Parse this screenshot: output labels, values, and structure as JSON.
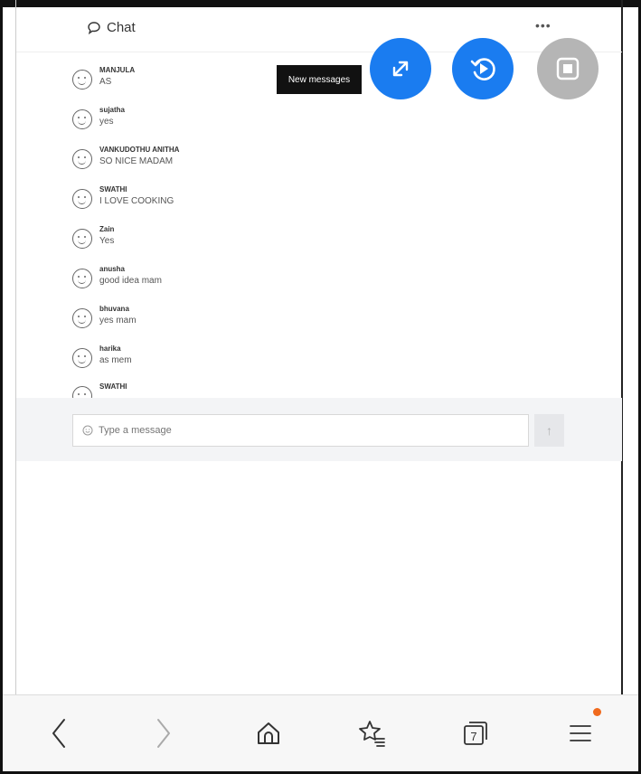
{
  "header": {
    "title": "Chat",
    "more_label": "•••"
  },
  "tooltip": "New messages",
  "messages": [
    {
      "name": "MANJULA",
      "text": "AS"
    },
    {
      "name": "sujatha",
      "text": "yes"
    },
    {
      "name": "VANKUDOTHU ANITHA",
      "text": "SO NICE MADAM"
    },
    {
      "name": "SWATHI",
      "text": "I LOVE COOKING"
    },
    {
      "name": "Zain",
      "text": "Yes"
    },
    {
      "name": "anusha",
      "text": "good idea mam"
    },
    {
      "name": "bhuvana",
      "text": "yes mam"
    },
    {
      "name": "harika",
      "text": "as mem"
    },
    {
      "name": "SWATHI",
      "text": ""
    }
  ],
  "composer": {
    "placeholder": "Type a message"
  },
  "send_icon": "arrow-up-icon",
  "fabs": [
    "expand-icon",
    "replay-icon",
    "stop-icon"
  ],
  "bottom_nav": {
    "tabs_count": "7"
  },
  "colors": {
    "fab_blue": "#1a7cf0",
    "fab_gray": "#b5b5b5",
    "badge": "#f06a1d",
    "tooltip_bg": "#111111"
  }
}
